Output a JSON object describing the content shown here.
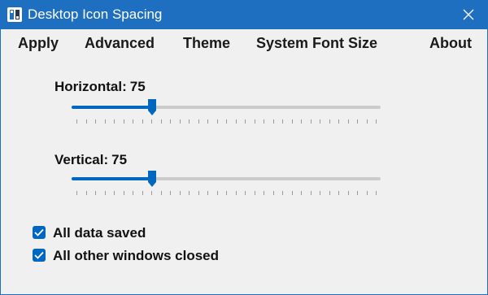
{
  "window": {
    "title": "Desktop Icon Spacing",
    "close_icon": "close-icon",
    "app_icon": "desktop-icon-spacing-app-icon"
  },
  "menu": {
    "items": [
      {
        "label": "Apply"
      },
      {
        "label": "Advanced"
      },
      {
        "label": "Theme"
      },
      {
        "label": "System Font Size"
      },
      {
        "label": "About"
      }
    ]
  },
  "sliders": {
    "horizontal": {
      "label": "Horizontal:",
      "value": "75",
      "fraction": 0.25
    },
    "vertical": {
      "label": "Vertical:",
      "value": "75",
      "fraction": 0.25
    }
  },
  "checkboxes": [
    {
      "label": "All data saved",
      "checked": true
    },
    {
      "label": "All other windows closed",
      "checked": true
    }
  ],
  "colors": {
    "accent": "#0067c0",
    "titlebar": "#1f6fc0",
    "background": "#f0f0f0"
  }
}
